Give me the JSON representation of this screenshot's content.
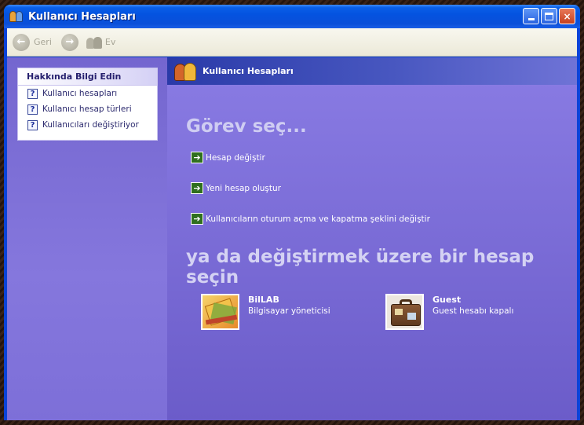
{
  "window": {
    "title": "Kullanıcı Hesapları"
  },
  "title_buttons": {
    "minimize": "minimize",
    "maximize": "maximize",
    "close": "×"
  },
  "toolbar": {
    "back_label": "Geri",
    "back_glyph": "←",
    "forward_glyph": "→",
    "home_label": "Ev"
  },
  "sidebar": {
    "panel_title": "Hakkında Bilgi Edin",
    "items": [
      {
        "label": "Kullanıcı hesapları"
      },
      {
        "label": "Kullanıcı hesap türleri"
      },
      {
        "label": "Kullanıcıları değiştiriyor"
      }
    ],
    "item_glyph": "?"
  },
  "main": {
    "header_title": "Kullanıcı Hesapları",
    "pick_task": "Görev seç...",
    "task_glyph": "➔",
    "tasks": [
      {
        "label": "Hesap değiştir"
      },
      {
        "label": "Yeni hesap oluştur"
      },
      {
        "label": "Kullanıcıların oturum açma ve kapatma şeklini değiştir"
      }
    ],
    "pick_account": "ya da değiştirmek üzere bir hesap seçin",
    "accounts": [
      {
        "name": "BilLAB",
        "desc": "Bilgisayar yöneticisi"
      },
      {
        "name": "Guest",
        "desc": "Guest hesabı kapalı"
      }
    ]
  }
}
